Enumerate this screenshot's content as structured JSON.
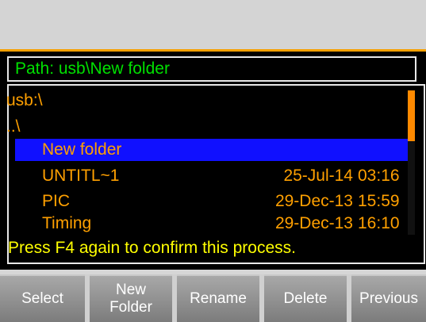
{
  "path": {
    "label": "Path: usb\\New folder"
  },
  "file_list": {
    "rows": [
      {
        "name": "usb:\\",
        "date": "",
        "time": ""
      },
      {
        "name": "..\\",
        "date": "",
        "time": ""
      },
      {
        "name": "New folder",
        "date": "",
        "time": "",
        "selected": true
      },
      {
        "name": "UNTITL~1",
        "date": "25-Jul-14",
        "time": "03:16"
      },
      {
        "name": "PIC",
        "date": "29-Dec-13",
        "time": "15:59"
      },
      {
        "name": "Timing",
        "date": "29-Dec-13",
        "time": "16:10"
      }
    ]
  },
  "message": "Press F4 again to confirm this process.",
  "softkeys": {
    "select": "Select",
    "new_folder": "New\nFolder",
    "rename": "Rename",
    "delete": "Delete",
    "previous": "Previous"
  },
  "colors": {
    "accent": "#f7a000",
    "path_text": "#00e000",
    "file_text": "#ffa000",
    "selection": "#1010ff",
    "message_text": "#ffff00"
  }
}
